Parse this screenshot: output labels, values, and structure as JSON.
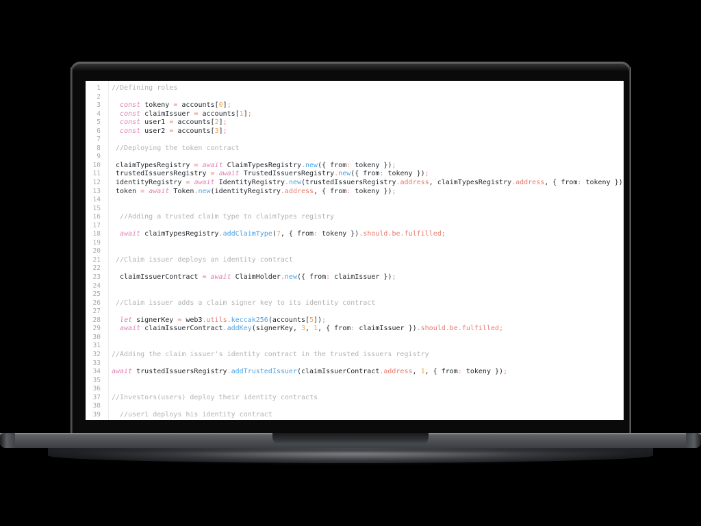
{
  "device": {
    "type": "laptop-mockup",
    "frame_color": "#2b2d30",
    "screen_background": "#ffffff"
  },
  "editor": {
    "name": "code-editor",
    "language": "javascript",
    "gutter_color": "#a9a9a9",
    "colors": {
      "comment": "#b3b3b3",
      "keyword": "#e17fb4",
      "operator": "#e8796b",
      "number": "#f4a04a",
      "function": "#4ba2e8",
      "text": "#24292e",
      "background": "#ffffff"
    },
    "lines": [
      {
        "n": "1",
        "tokens": [
          {
            "t": "//Defining roles",
            "c": "com"
          }
        ]
      },
      {
        "n": "2",
        "tokens": []
      },
      {
        "n": "3",
        "tokens": [
          {
            "t": "  ",
            "c": "txt"
          },
          {
            "t": "const",
            "c": "kw"
          },
          {
            "t": " tokeny ",
            "c": "txt"
          },
          {
            "t": "=",
            "c": "op"
          },
          {
            "t": " accounts[",
            "c": "txt"
          },
          {
            "t": "0",
            "c": "num"
          },
          {
            "t": "]",
            "c": "txt"
          },
          {
            "t": ";",
            "c": "pun"
          }
        ]
      },
      {
        "n": "4",
        "tokens": [
          {
            "t": "  ",
            "c": "txt"
          },
          {
            "t": "const",
            "c": "kw"
          },
          {
            "t": " claimIssuer ",
            "c": "txt"
          },
          {
            "t": "=",
            "c": "op"
          },
          {
            "t": " accounts[",
            "c": "txt"
          },
          {
            "t": "1",
            "c": "num"
          },
          {
            "t": "]",
            "c": "txt"
          },
          {
            "t": ";",
            "c": "pun"
          }
        ]
      },
      {
        "n": "5",
        "tokens": [
          {
            "t": "  ",
            "c": "txt"
          },
          {
            "t": "const",
            "c": "kw"
          },
          {
            "t": " user1 ",
            "c": "txt"
          },
          {
            "t": "=",
            "c": "op"
          },
          {
            "t": " accounts[",
            "c": "txt"
          },
          {
            "t": "2",
            "c": "num"
          },
          {
            "t": "]",
            "c": "txt"
          },
          {
            "t": ";",
            "c": "pun"
          }
        ]
      },
      {
        "n": "6",
        "tokens": [
          {
            "t": "  ",
            "c": "txt"
          },
          {
            "t": "const",
            "c": "kw"
          },
          {
            "t": " user2 ",
            "c": "txt"
          },
          {
            "t": "=",
            "c": "op"
          },
          {
            "t": " accounts[",
            "c": "txt"
          },
          {
            "t": "3",
            "c": "num"
          },
          {
            "t": "]",
            "c": "txt"
          },
          {
            "t": ";",
            "c": "pun"
          }
        ]
      },
      {
        "n": "7",
        "tokens": []
      },
      {
        "n": "8",
        "tokens": [
          {
            "t": " //Deploying the token contract",
            "c": "com"
          }
        ]
      },
      {
        "n": "9",
        "tokens": []
      },
      {
        "n": "10",
        "tokens": [
          {
            "t": " claimTypesRegistry ",
            "c": "txt"
          },
          {
            "t": "=",
            "c": "op"
          },
          {
            "t": " ",
            "c": "txt"
          },
          {
            "t": "await",
            "c": "kw"
          },
          {
            "t": " ClaimTypesRegistry",
            "c": "txt"
          },
          {
            "t": ".",
            "c": "pun"
          },
          {
            "t": "new",
            "c": "fn"
          },
          {
            "t": "({ from",
            "c": "txt"
          },
          {
            "t": ":",
            "c": "pun"
          },
          {
            "t": " tokeny })",
            "c": "txt"
          },
          {
            "t": ";",
            "c": "pun"
          }
        ]
      },
      {
        "n": "11",
        "tokens": [
          {
            "t": " trustedIssuersRegistry ",
            "c": "txt"
          },
          {
            "t": "=",
            "c": "op"
          },
          {
            "t": " ",
            "c": "txt"
          },
          {
            "t": "await",
            "c": "kw"
          },
          {
            "t": " TrustedIssuersRegistry",
            "c": "txt"
          },
          {
            "t": ".",
            "c": "pun"
          },
          {
            "t": "new",
            "c": "fn"
          },
          {
            "t": "({ from",
            "c": "txt"
          },
          {
            "t": ":",
            "c": "pun"
          },
          {
            "t": " tokeny })",
            "c": "txt"
          },
          {
            "t": ";",
            "c": "pun"
          }
        ]
      },
      {
        "n": "12",
        "tokens": [
          {
            "t": " identityRegistry ",
            "c": "txt"
          },
          {
            "t": "=",
            "c": "op"
          },
          {
            "t": " ",
            "c": "txt"
          },
          {
            "t": "await",
            "c": "kw"
          },
          {
            "t": " IdentityRegistry",
            "c": "txt"
          },
          {
            "t": ".",
            "c": "pun"
          },
          {
            "t": "new",
            "c": "fn"
          },
          {
            "t": "(trustedIssuersRegistry",
            "c": "txt"
          },
          {
            "t": ".address",
            "c": "prop"
          },
          {
            "t": ", claimTypesRegistry",
            "c": "txt"
          },
          {
            "t": ".address",
            "c": "prop"
          },
          {
            "t": ", { from",
            "c": "txt"
          },
          {
            "t": ":",
            "c": "pun"
          },
          {
            "t": " tokeny })",
            "c": "txt"
          },
          {
            "t": ";",
            "c": "pun"
          }
        ]
      },
      {
        "n": "13",
        "tokens": [
          {
            "t": " token ",
            "c": "txt"
          },
          {
            "t": "=",
            "c": "op"
          },
          {
            "t": " ",
            "c": "txt"
          },
          {
            "t": "await",
            "c": "kw"
          },
          {
            "t": " Token",
            "c": "txt"
          },
          {
            "t": ".",
            "c": "pun"
          },
          {
            "t": "new",
            "c": "fn"
          },
          {
            "t": "(identityRegistry",
            "c": "txt"
          },
          {
            "t": ".address",
            "c": "prop"
          },
          {
            "t": ", { from",
            "c": "txt"
          },
          {
            "t": ":",
            "c": "pun"
          },
          {
            "t": " tokeny })",
            "c": "txt"
          },
          {
            "t": ";",
            "c": "pun"
          }
        ]
      },
      {
        "n": "14",
        "tokens": []
      },
      {
        "n": "15",
        "tokens": []
      },
      {
        "n": "16",
        "tokens": [
          {
            "t": "  //Adding a trusted claim type to claimTypes registry",
            "c": "com"
          }
        ]
      },
      {
        "n": "17",
        "tokens": []
      },
      {
        "n": "18",
        "tokens": [
          {
            "t": "  ",
            "c": "txt"
          },
          {
            "t": "await",
            "c": "kw"
          },
          {
            "t": " claimTypesRegistry",
            "c": "txt"
          },
          {
            "t": ".",
            "c": "pun"
          },
          {
            "t": "addClaimType",
            "c": "fn"
          },
          {
            "t": "(",
            "c": "txt"
          },
          {
            "t": "7",
            "c": "num"
          },
          {
            "t": ", { from",
            "c": "txt"
          },
          {
            "t": ":",
            "c": "pun"
          },
          {
            "t": " tokeny })",
            "c": "txt"
          },
          {
            "t": ".should",
            "c": "prop"
          },
          {
            "t": ".be",
            "c": "prop"
          },
          {
            "t": ".fulfilled",
            "c": "prop"
          },
          {
            "t": ";",
            "c": "pun"
          }
        ]
      },
      {
        "n": "19",
        "tokens": []
      },
      {
        "n": "20",
        "tokens": []
      },
      {
        "n": "21",
        "tokens": [
          {
            "t": " //Claim issuer deploys an identity contract",
            "c": "com"
          }
        ]
      },
      {
        "n": "22",
        "tokens": []
      },
      {
        "n": "23",
        "tokens": [
          {
            "t": "  claimIssuerContract ",
            "c": "txt"
          },
          {
            "t": "=",
            "c": "op"
          },
          {
            "t": " ",
            "c": "txt"
          },
          {
            "t": "await",
            "c": "kw"
          },
          {
            "t": " ClaimHolder",
            "c": "txt"
          },
          {
            "t": ".",
            "c": "pun"
          },
          {
            "t": "new",
            "c": "fn"
          },
          {
            "t": "({ from",
            "c": "txt"
          },
          {
            "t": ":",
            "c": "pun"
          },
          {
            "t": " claimIssuer })",
            "c": "txt"
          },
          {
            "t": ";",
            "c": "pun"
          }
        ]
      },
      {
        "n": "24",
        "tokens": []
      },
      {
        "n": "25",
        "tokens": []
      },
      {
        "n": "26",
        "tokens": [
          {
            "t": " //Claim issuer adds a claim signer key to its identity contract",
            "c": "com"
          }
        ]
      },
      {
        "n": "27",
        "tokens": []
      },
      {
        "n": "28",
        "tokens": [
          {
            "t": "  ",
            "c": "txt"
          },
          {
            "t": "let",
            "c": "kw"
          },
          {
            "t": " signerKey ",
            "c": "txt"
          },
          {
            "t": "=",
            "c": "op"
          },
          {
            "t": " web3",
            "c": "txt"
          },
          {
            "t": ".utils",
            "c": "prop"
          },
          {
            "t": ".",
            "c": "pun"
          },
          {
            "t": "keccak256",
            "c": "fn"
          },
          {
            "t": "(accounts[",
            "c": "txt"
          },
          {
            "t": "5",
            "c": "num"
          },
          {
            "t": "])",
            "c": "txt"
          },
          {
            "t": ";",
            "c": "pun"
          }
        ]
      },
      {
        "n": "29",
        "tokens": [
          {
            "t": "  ",
            "c": "txt"
          },
          {
            "t": "await",
            "c": "kw"
          },
          {
            "t": " claimIssuerContract",
            "c": "txt"
          },
          {
            "t": ".",
            "c": "pun"
          },
          {
            "t": "addKey",
            "c": "fn"
          },
          {
            "t": "(signerKey, ",
            "c": "txt"
          },
          {
            "t": "3",
            "c": "num"
          },
          {
            "t": ", ",
            "c": "txt"
          },
          {
            "t": "1",
            "c": "num"
          },
          {
            "t": ", { from",
            "c": "txt"
          },
          {
            "t": ":",
            "c": "pun"
          },
          {
            "t": " claimIssuer })",
            "c": "txt"
          },
          {
            "t": ".should",
            "c": "prop"
          },
          {
            "t": ".be",
            "c": "prop"
          },
          {
            "t": ".fulfilled",
            "c": "prop"
          },
          {
            "t": ";",
            "c": "pun"
          }
        ]
      },
      {
        "n": "30",
        "tokens": []
      },
      {
        "n": "31",
        "tokens": []
      },
      {
        "n": "32",
        "tokens": [
          {
            "t": "//Adding the claim issuer's identity contract in the trusted issuers registry",
            "c": "com"
          }
        ]
      },
      {
        "n": "33",
        "tokens": []
      },
      {
        "n": "34",
        "tokens": [
          {
            "t": "await",
            "c": "kw"
          },
          {
            "t": " trustedIssuersRegistry",
            "c": "txt"
          },
          {
            "t": ".",
            "c": "pun"
          },
          {
            "t": "addTrustedIssuer",
            "c": "fn"
          },
          {
            "t": "(claimIssuerContract",
            "c": "txt"
          },
          {
            "t": ".address",
            "c": "prop"
          },
          {
            "t": ", ",
            "c": "txt"
          },
          {
            "t": "1",
            "c": "num"
          },
          {
            "t": ", { from",
            "c": "txt"
          },
          {
            "t": ":",
            "c": "pun"
          },
          {
            "t": " tokeny })",
            "c": "txt"
          },
          {
            "t": ";",
            "c": "pun"
          }
        ]
      },
      {
        "n": "35",
        "tokens": []
      },
      {
        "n": "36",
        "tokens": []
      },
      {
        "n": "37",
        "tokens": [
          {
            "t": "//Investors(users) deploy their identity contracts",
            "c": "com"
          }
        ]
      },
      {
        "n": "38",
        "tokens": []
      },
      {
        "n": "39",
        "tokens": [
          {
            "t": "  //user1 deploys his identity contract",
            "c": "com"
          }
        ]
      }
    ]
  }
}
